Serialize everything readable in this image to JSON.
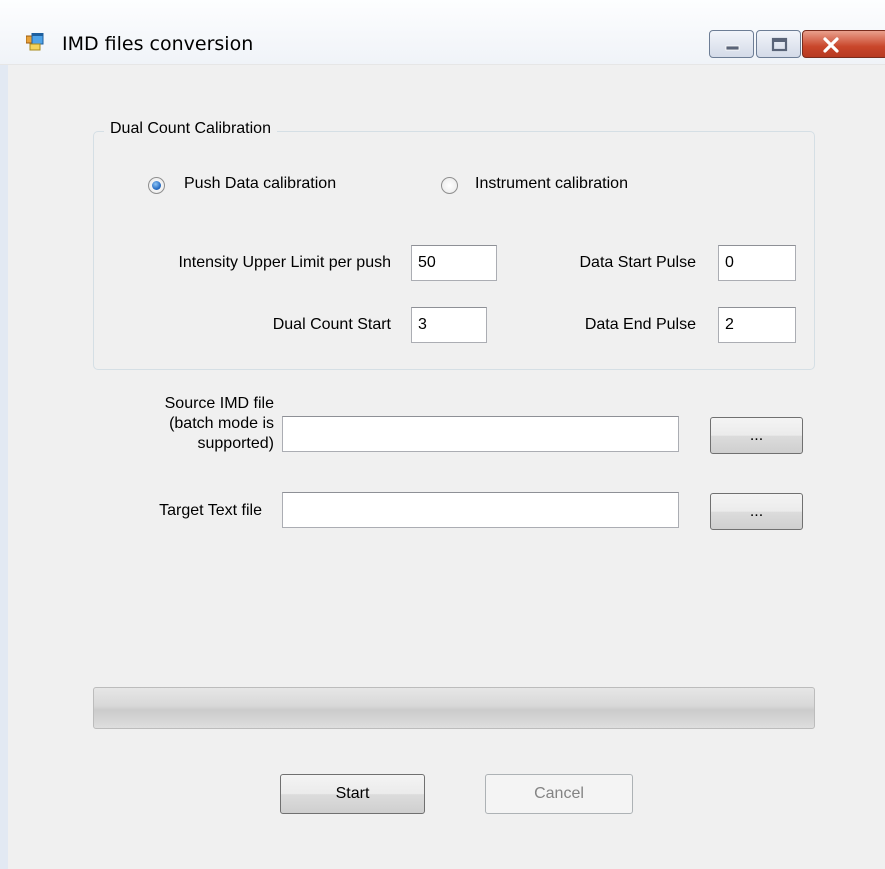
{
  "window": {
    "title": "IMD files conversion"
  },
  "calibration": {
    "group_title": "Dual Count Calibration",
    "options": [
      {
        "label": "Push Data calibration",
        "checked": true
      },
      {
        "label": "Instrument calibration",
        "checked": false
      }
    ],
    "intensity_upper_limit": {
      "label": "Intensity Upper Limit per push",
      "value": "50"
    },
    "dual_count_start": {
      "label": "Dual Count Start",
      "value": "3"
    },
    "data_start_pulse": {
      "label": "Data Start Pulse",
      "value": "0"
    },
    "data_end_pulse": {
      "label": "Data End Pulse",
      "value": "2"
    }
  },
  "files": {
    "source_label_lines": [
      "Source IMD file",
      "(batch mode is",
      "supported)"
    ],
    "source_value": "",
    "source_browse_label": "...",
    "target_label": "Target Text file",
    "target_value": "",
    "target_browse_label": "..."
  },
  "progress": {
    "fraction": 0
  },
  "actions": {
    "start_label": "Start",
    "cancel_label": "Cancel",
    "cancel_enabled": false
  },
  "colors": {
    "window_bg": "#f0f0f0",
    "close_button": "#c9462b",
    "radio_checked": "#2a6fc5"
  }
}
